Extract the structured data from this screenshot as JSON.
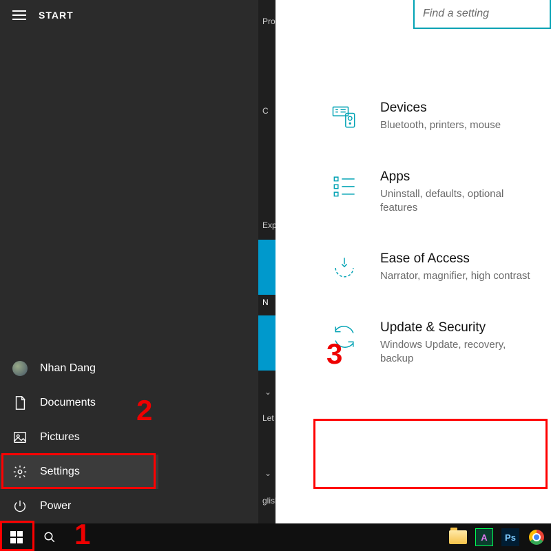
{
  "start": {
    "label": "START",
    "user": "Nhan Dang",
    "rail": {
      "documents": "Documents",
      "pictures": "Pictures",
      "settings": "Settings",
      "power": "Power"
    },
    "tiles": {
      "group1": "Pro",
      "group2": "Exp",
      "group3": "Let",
      "lang": "glish",
      "letterC": "C",
      "letterN": "N"
    }
  },
  "settings_panel": {
    "search_placeholder": "Find a setting",
    "items": [
      {
        "title": "Devices",
        "desc": "Bluetooth, printers, mouse"
      },
      {
        "title": "Apps",
        "desc": "Uninstall, defaults, optional features"
      },
      {
        "title": "Ease of Access",
        "desc": "Narrator, magnifier, high contrast"
      },
      {
        "title": "Update & Security",
        "desc": "Windows Update, recovery, backup"
      }
    ]
  },
  "annotations": {
    "n1": "1",
    "n2": "2",
    "n3": "3"
  },
  "colors": {
    "accent": "#00a2b4",
    "highlight_red": "#f00"
  }
}
